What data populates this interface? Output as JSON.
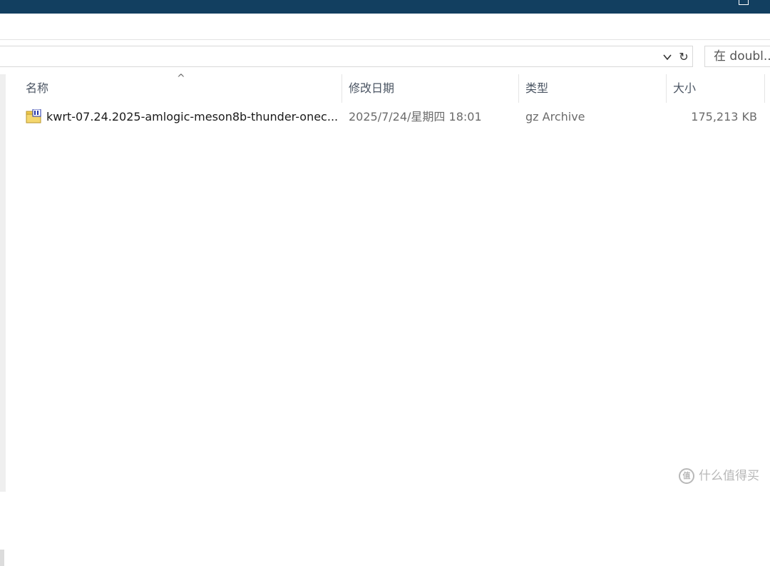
{
  "window": {
    "restore_icon": "restore-window-icon"
  },
  "address_bar": {
    "dropdown_icon": "chevron-down-icon",
    "refresh_icon": "refresh-icon",
    "refresh_glyph": "↻"
  },
  "search": {
    "placeholder": "在 doubl..."
  },
  "columns": {
    "name": "名称",
    "date": "修改日期",
    "type": "类型",
    "size": "大小",
    "sort_glyph": "^"
  },
  "files": [
    {
      "name": "kwrt-07.24.2025-amlogic-meson8b-thunder-onec...",
      "modified": "2025/7/24/星期四 18:01",
      "type": "gz Archive",
      "size": "175,213 KB",
      "icon": "archive-file-icon"
    }
  ],
  "watermark": {
    "glyph": "值",
    "text": "什么值得买"
  }
}
